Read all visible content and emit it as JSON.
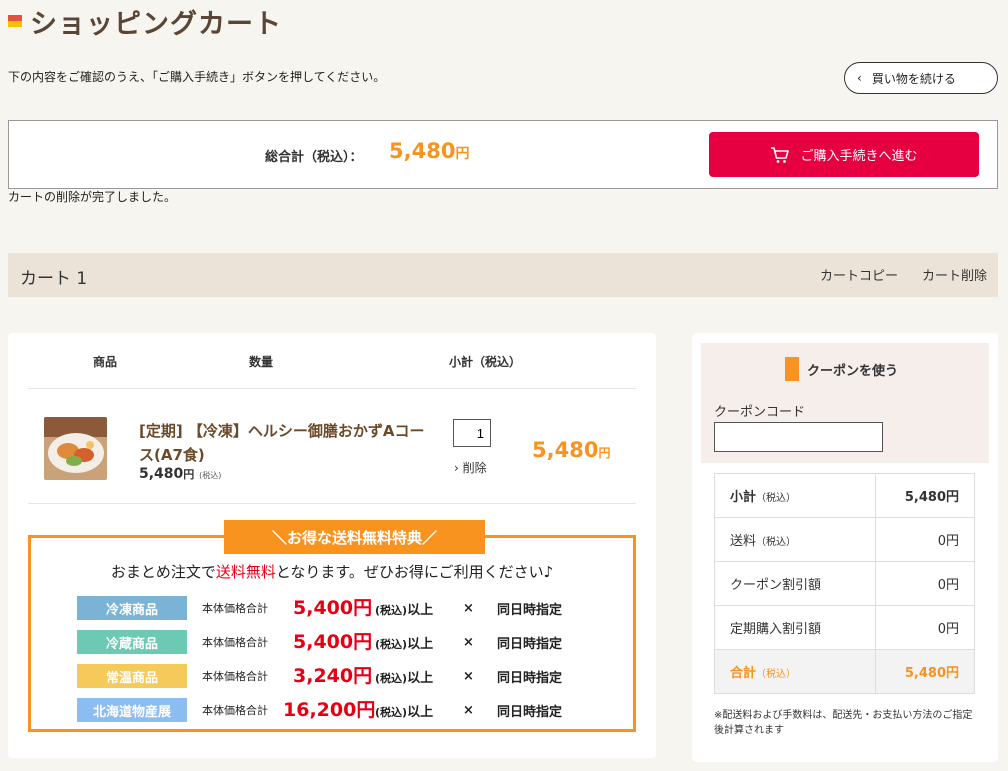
{
  "page": {
    "title": "ショッピングカート",
    "instruction": "下の内容をご確認のうえ、「ご購入手続き」ボタンを押してください。",
    "continue_label": "買い物を続ける",
    "deleted_message": "カートの削除が完了しました。"
  },
  "total_bar": {
    "label": "総合計（税込）：",
    "amount": "5,480",
    "yen": "円",
    "checkout_label": "ご購入手続きへ進む"
  },
  "cart": {
    "name": "カート 1",
    "copy_label": "カートコピー",
    "delete_label": "カート削除",
    "columns": {
      "product": "商品",
      "quantity": "数量",
      "subtotal": "小計（税込）"
    },
    "item": {
      "name": "[定期] 【冷凍】ヘルシー御膳おかずAコース(A7食)",
      "price": "5,480",
      "price_yen": "円",
      "price_tax": "(税込)",
      "quantity": "1",
      "delete_label": "削除",
      "subtotal": "5,480",
      "subtotal_yen": "円"
    }
  },
  "promo": {
    "tab": "＼お得な送料無料特典／",
    "msg_before": "おまとめ注文で",
    "msg_highlight": "送料無料",
    "msg_after": "となります。ぜひお得にご利用ください♪",
    "base_label": "本体価格合計",
    "tax_label": "(税込)",
    "cond_suffix": "以上",
    "times": "×",
    "same_time": "同日時指定",
    "rows": [
      {
        "category": "冷凍商品",
        "color": "#7ab3d6",
        "amount": "5,400円"
      },
      {
        "category": "冷蔵商品",
        "color": "#6cc9b3",
        "amount": "5,400円"
      },
      {
        "category": "常温商品",
        "color": "#f5c95a",
        "amount": "3,240円"
      },
      {
        "category": "北海道物産展",
        "color": "#8bbdf2",
        "amount": "16,200円"
      }
    ]
  },
  "coupon": {
    "title": "クーポンを使う",
    "code_label": "クーポンコード",
    "code_value": ""
  },
  "summary": {
    "rows": [
      {
        "label": "小計",
        "tax": "（税込）",
        "value": "5,480円"
      },
      {
        "label": "送料",
        "tax": "（税込）",
        "value": "0円"
      },
      {
        "label": "クーポン割引額",
        "tax": "",
        "value": "0円"
      },
      {
        "label": "定期購入割引額",
        "tax": "",
        "value": "0円"
      },
      {
        "label": "合計",
        "tax": "（税込）",
        "value": "5,480円"
      }
    ],
    "footnote": "※配送料および手数料は、配送先・お支払い方法のご指定後計算されます"
  },
  "colors": {
    "accent_orange": "#f7931e",
    "checkout_red": "#e60041",
    "title_brown": "#5a4636"
  },
  "icons": {
    "continue": "chevron-left-icon",
    "checkout": "cart-icon",
    "delete": "chevron-right-icon",
    "coupon": "coupon-ticket-icon"
  }
}
